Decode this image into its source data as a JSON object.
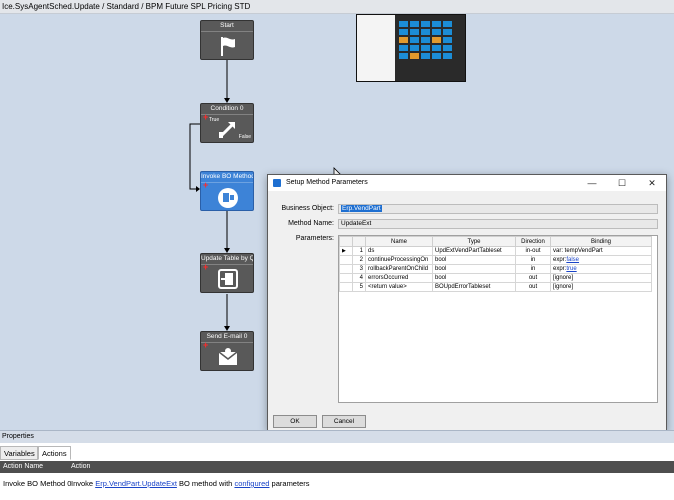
{
  "window_title": "Ice.SysAgentSched.Update / Standard / BPM Future SPL Pricing STD",
  "nodes": {
    "start": "Start",
    "condition": "Condition 0",
    "condition_true": "True",
    "condition_false": "False",
    "invoke": "Invoke BO Method",
    "update": "Update Table by Q",
    "email": "Send E-mail 0"
  },
  "dialog": {
    "title": "Setup Method Parameters",
    "business_object_label": "Business Object:",
    "business_object_value": "Erp.VendPart",
    "method_name_label": "Method Name:",
    "method_name_value": "UpdateExt",
    "parameters_label": "Parameters:",
    "columns": [
      "Name",
      "Type",
      "Direction",
      "Binding"
    ],
    "rows": [
      {
        "num": "1",
        "name": "ds",
        "type": "UpdExtVendPartTableset",
        "direction": "in-out",
        "binding_prefix": "var: tempVendPart",
        "binding_link": ""
      },
      {
        "num": "2",
        "name": "continueProcessingOn",
        "type": "bool",
        "direction": "in",
        "binding_prefix": "expr:",
        "binding_link": "false"
      },
      {
        "num": "3",
        "name": "rollbackParentOnChild",
        "type": "bool",
        "direction": "in",
        "binding_prefix": "expr:",
        "binding_link": "true"
      },
      {
        "num": "4",
        "name": "errorsOccurred",
        "type": "bool",
        "direction": "out",
        "binding_prefix": "[ignore]",
        "binding_link": ""
      },
      {
        "num": "5",
        "name": "<return value>",
        "type": "BOUpdErrorTableset",
        "direction": "out",
        "binding_prefix": "[ignore]",
        "binding_link": ""
      }
    ],
    "ok": "OK",
    "cancel": "Cancel"
  },
  "properties": {
    "header": "Properties",
    "tabs": [
      "Variables",
      "Actions"
    ],
    "active_tab": "Actions",
    "columns": [
      "Action Name",
      "Action"
    ],
    "row": {
      "action_name": "Invoke BO Method 0",
      "text1": "Invoke ",
      "link1": "Erp.VendPart.UpdateExt",
      "text2": " BO method with ",
      "link2": "configured",
      "text3": " parameters"
    }
  },
  "colors": {
    "canvas_bg": "#cdd9e8",
    "node_bg": "#595959",
    "node_selected": "#3d83d7",
    "plus_red": "#ff2a2a",
    "link": "#1a44c8"
  },
  "icons": [
    "flag-icon",
    "condition-icon",
    "invoke-method-icon",
    "update-table-icon",
    "email-icon",
    "minimize-icon",
    "maximize-icon",
    "close-icon",
    "row-pointer-icon"
  ]
}
